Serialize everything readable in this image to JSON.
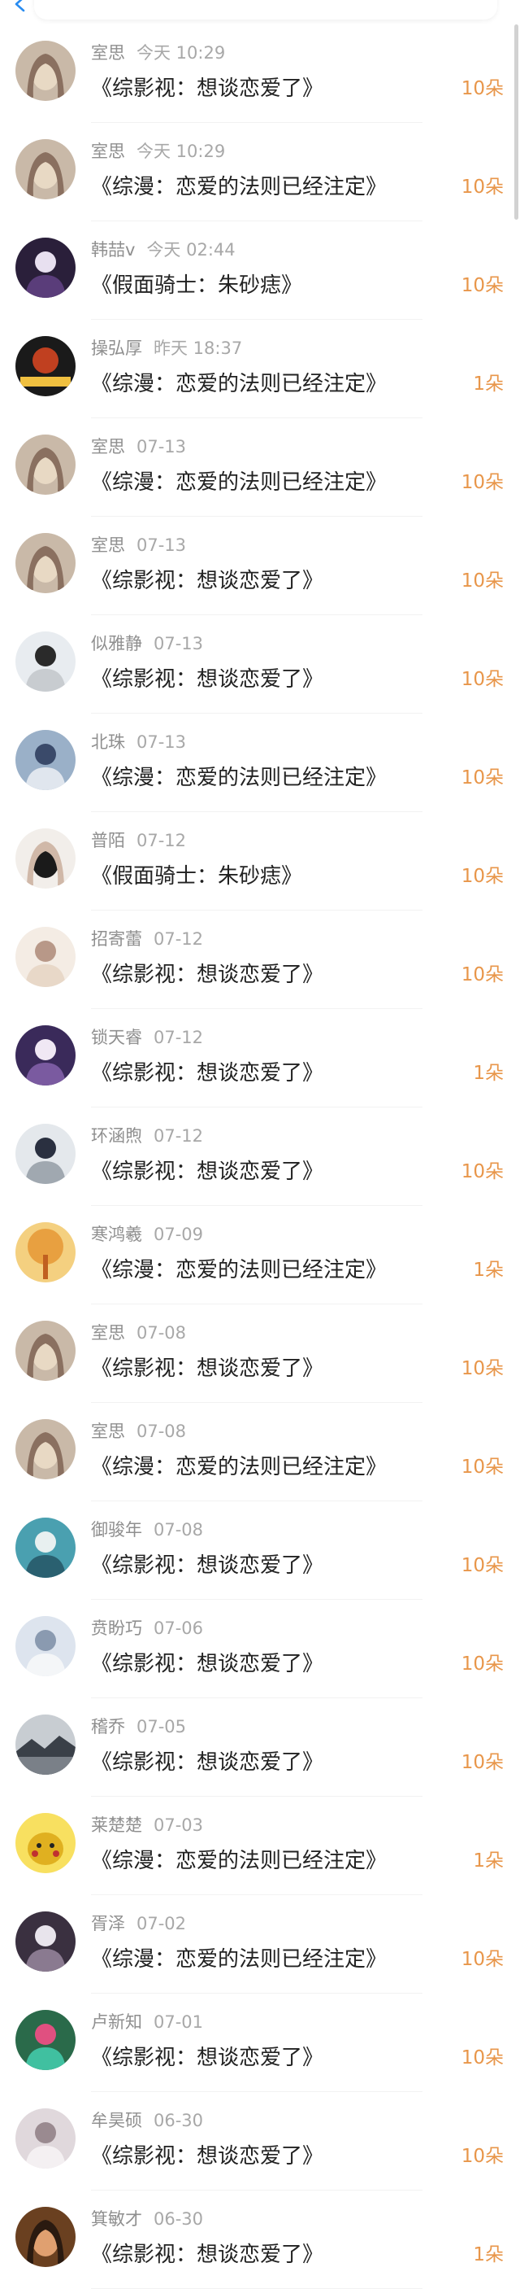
{
  "header": {
    "back_icon": "chevron-left-icon",
    "accent": "#2a8cf0"
  },
  "colors": {
    "count": "#e8964a",
    "meta": "#9a9a9a",
    "title": "#222222"
  },
  "rows": [
    {
      "name": "室思",
      "time": "今天 10:29",
      "title": "《综影视：想谈恋爱了》",
      "count": "10朵",
      "avatar": "a1"
    },
    {
      "name": "室思",
      "time": "今天 10:29",
      "title": "《综漫：恋爱的法则已经注定》",
      "count": "10朵",
      "avatar": "a1"
    },
    {
      "name": "韩喆v",
      "time": "今天 02:44",
      "title": "《假面骑士：朱砂痣》",
      "count": "10朵",
      "avatar": "a2"
    },
    {
      "name": "操弘厚",
      "time": "昨天 18:37",
      "title": "《综漫：恋爱的法则已经注定》",
      "count": "1朵",
      "avatar": "a3"
    },
    {
      "name": "室思",
      "time": "07-13",
      "title": "《综漫：恋爱的法则已经注定》",
      "count": "10朵",
      "avatar": "a1"
    },
    {
      "name": "室思",
      "time": "07-13",
      "title": "《综影视：想谈恋爱了》",
      "count": "10朵",
      "avatar": "a1"
    },
    {
      "name": "似雅静",
      "time": "07-13",
      "title": "《综影视：想谈恋爱了》",
      "count": "10朵",
      "avatar": "a4"
    },
    {
      "name": "北珠",
      "time": "07-13",
      "title": "《综漫：恋爱的法则已经注定》",
      "count": "10朵",
      "avatar": "a5"
    },
    {
      "name": "普陌",
      "time": "07-12",
      "title": "《假面骑士：朱砂痣》",
      "count": "10朵",
      "avatar": "a6"
    },
    {
      "name": "招寄蕾",
      "time": "07-12",
      "title": "《综影视：想谈恋爱了》",
      "count": "10朵",
      "avatar": "a7"
    },
    {
      "name": "锁天睿",
      "time": "07-12",
      "title": "《综影视：想谈恋爱了》",
      "count": "1朵",
      "avatar": "a8"
    },
    {
      "name": "环涵煦",
      "time": "07-12",
      "title": "《综影视：想谈恋爱了》",
      "count": "10朵",
      "avatar": "a9"
    },
    {
      "name": "寒鸿羲",
      "time": "07-09",
      "title": "《综漫：恋爱的法则已经注定》",
      "count": "1朵",
      "avatar": "a10"
    },
    {
      "name": "室思",
      "time": "07-08",
      "title": "《综影视：想谈恋爱了》",
      "count": "10朵",
      "avatar": "a1"
    },
    {
      "name": "室思",
      "time": "07-08",
      "title": "《综漫：恋爱的法则已经注定》",
      "count": "10朵",
      "avatar": "a1"
    },
    {
      "name": "御骏年",
      "time": "07-08",
      "title": "《综影视：想谈恋爱了》",
      "count": "10朵",
      "avatar": "a11"
    },
    {
      "name": "贲盼巧",
      "time": "07-06",
      "title": "《综影视：想谈恋爱了》",
      "count": "10朵",
      "avatar": "a12"
    },
    {
      "name": "稽乔",
      "time": "07-05",
      "title": "《综影视：想谈恋爱了》",
      "count": "10朵",
      "avatar": "a13"
    },
    {
      "name": "莱楚楚",
      "time": "07-03",
      "title": "《综漫：恋爱的法则已经注定》",
      "count": "1朵",
      "avatar": "a14"
    },
    {
      "name": "胥泽",
      "time": "07-02",
      "title": "《综漫：恋爱的法则已经注定》",
      "count": "10朵",
      "avatar": "a15"
    },
    {
      "name": "卢新知",
      "time": "07-01",
      "title": "《综影视：想谈恋爱了》",
      "count": "10朵",
      "avatar": "a16"
    },
    {
      "name": "牟昊硕",
      "time": "06-30",
      "title": "《综影视：想谈恋爱了》",
      "count": "10朵",
      "avatar": "a17"
    },
    {
      "name": "箕敏才",
      "time": "06-30",
      "title": "《综影视：想谈恋爱了》",
      "count": "1朵",
      "avatar": "a18"
    }
  ]
}
